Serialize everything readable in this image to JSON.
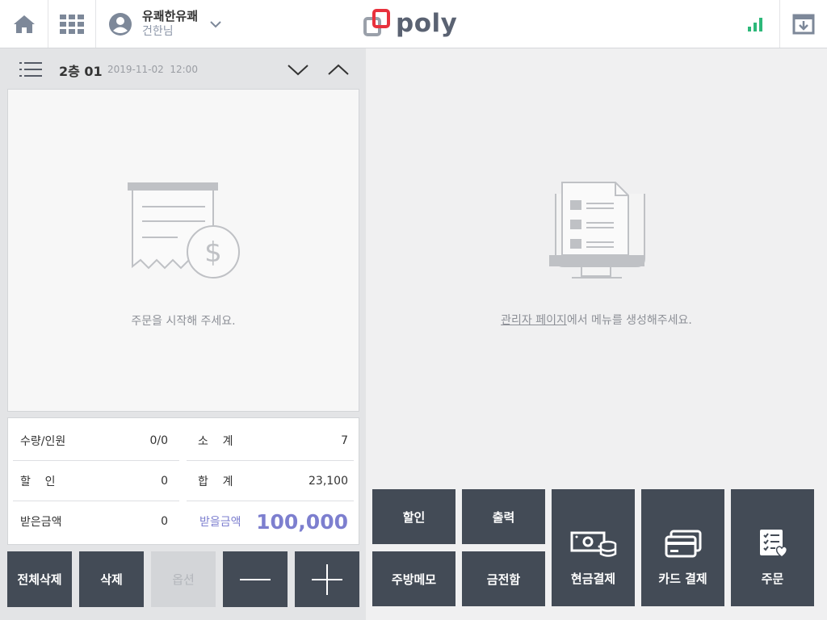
{
  "topbar": {
    "user_name": "유쾌한유쾌",
    "user_sub": "건한님",
    "logo_text": "poly",
    "colors": {
      "logo_accent": "#e8313d",
      "signal": "#2db87a",
      "icon": "#7d8899"
    }
  },
  "order": {
    "table_name": "2층 01",
    "datetime": "2019-11-02  12:00",
    "empty_message": "주문을 시작해 주세요."
  },
  "summary": {
    "qty_label": "수량/인원",
    "qty_value": "0/0",
    "subtotal_label": "소    계",
    "subtotal_value": "7",
    "discount_label": "할    인",
    "discount_value": "0",
    "total_label": "합    계",
    "total_value": "23,100",
    "received_label": "받은금액",
    "received_value": "0",
    "due_label": "받을금액",
    "due_value": "100,000"
  },
  "left_buttons": {
    "clear_all": "전체삭제",
    "delete": "삭제",
    "option": "옵션"
  },
  "menu": {
    "empty_link": "관리자 페이지",
    "empty_rest": "에서 메뉴를 생성해주세요."
  },
  "actions": {
    "discount": "할인",
    "print": "출력",
    "kitchen_memo": "주방메모",
    "cash_drawer": "금전함",
    "cash_pay": "현금결제",
    "card_pay": "카드 결제",
    "order": "주문"
  }
}
